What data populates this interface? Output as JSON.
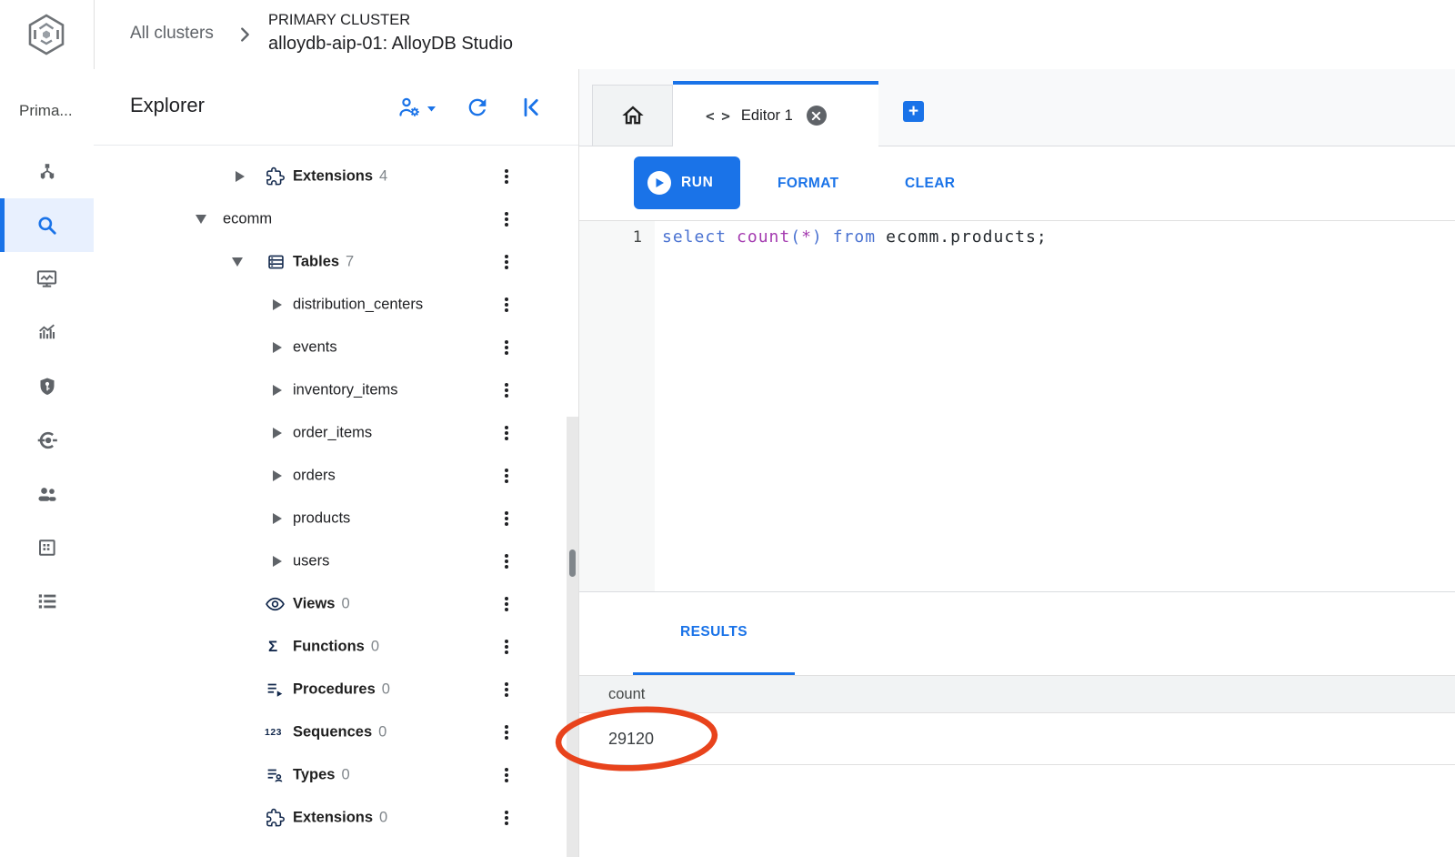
{
  "header": {
    "breadcrumb": {
      "all_clusters": "All clusters",
      "cluster_type": "PRIMARY CLUSTER",
      "page_title": "alloydb-aip-01: AlloyDB Studio"
    }
  },
  "left_rail": {
    "project_label": "Prima..."
  },
  "explorer": {
    "title": "Explorer",
    "icon_glyphs": {
      "functions": "Σ",
      "sequences": "123"
    },
    "tree": [
      {
        "label": "Extensions",
        "count": "4"
      },
      {
        "label": "ecomm",
        "count": ""
      },
      {
        "label": "Tables",
        "count": "7"
      },
      {
        "label": "distribution_centers",
        "count": ""
      },
      {
        "label": "events",
        "count": ""
      },
      {
        "label": "inventory_items",
        "count": ""
      },
      {
        "label": "order_items",
        "count": ""
      },
      {
        "label": "orders",
        "count": ""
      },
      {
        "label": "products",
        "count": ""
      },
      {
        "label": "users",
        "count": ""
      },
      {
        "label": "Views",
        "count": "0"
      },
      {
        "label": "Functions",
        "count": "0"
      },
      {
        "label": "Procedures",
        "count": "0"
      },
      {
        "label": "Sequences",
        "count": "0"
      },
      {
        "label": "Types",
        "count": "0"
      },
      {
        "label": "Extensions",
        "count": "0"
      }
    ]
  },
  "editor": {
    "tabs": {
      "editor_tab_label": "Editor 1",
      "code_icon_glyph": "< >",
      "add_tab_glyph": "+"
    },
    "toolbar": {
      "run": "RUN",
      "format": "FORMAT",
      "clear": "CLEAR"
    },
    "code": {
      "line_number": "1",
      "kw_select": "select",
      "fn_count": "count",
      "paren_open": "(",
      "star": "*",
      "paren_close": ")",
      "kw_from": "from",
      "identifier": "ecomm.products;"
    }
  },
  "results": {
    "tab_label": "RESULTS",
    "column_header": "count",
    "row_value": "29120"
  },
  "colors": {
    "accent_blue": "#1a73e8",
    "active_nav_bg": "#e8f0fe",
    "annotation_red": "#e8431c",
    "sql_keyword": "#4a72d1",
    "sql_function": "#a43bb0",
    "header_row_bg": "#f1f3f4"
  }
}
